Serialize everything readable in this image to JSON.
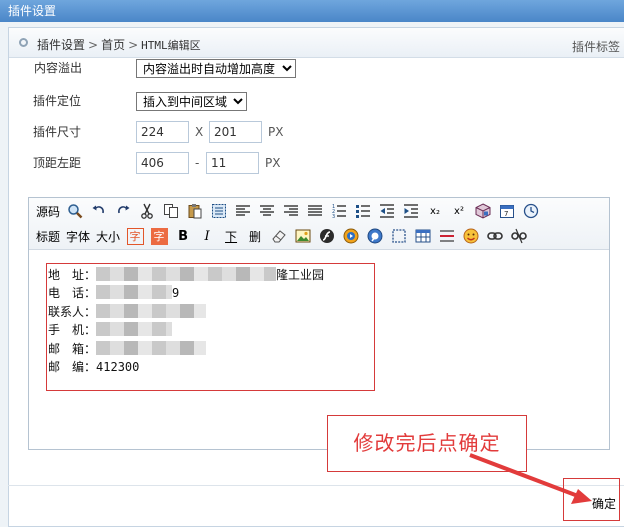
{
  "window": {
    "title": "插件设置"
  },
  "breadcrumb": {
    "items": [
      "插件设置",
      "首页",
      "HTML编辑区"
    ],
    "separator": ">",
    "right_label": "插件标签"
  },
  "form": {
    "overflow": {
      "label": "内容溢出",
      "value": "内容溢出时自动增加高度"
    },
    "position": {
      "label": "插件定位",
      "value": "插入到中间区域"
    },
    "size": {
      "label": "插件尺寸",
      "width": "224",
      "x": "X",
      "height": "201",
      "unit": "PX"
    },
    "offset": {
      "label": "顶距左距",
      "top": "406",
      "dash": "-",
      "left": "11",
      "unit": "PX"
    }
  },
  "toolbar": {
    "source": "源码",
    "title": "标题",
    "font": "字体",
    "size": "大小",
    "font_color": "字",
    "bg_color": "字",
    "bold": "B",
    "italic": "I",
    "underline": "下",
    "strike": "删",
    "sub": "x₂",
    "sup": "x²"
  },
  "editor_content": {
    "lines": [
      {
        "label": "地　址：",
        "visible_tail": "隆工业园"
      },
      {
        "label": "电　话：",
        "visible_tail": "9"
      },
      {
        "label": "联系人：",
        "visible_tail": ""
      },
      {
        "label": "手　机：",
        "visible_tail": ""
      },
      {
        "label": "邮　箱：",
        "visible_tail": ""
      },
      {
        "label": "邮　编：",
        "visible_tail": "412300"
      }
    ]
  },
  "annotation": {
    "text": "修改完后点确定",
    "color": "#e23b3b"
  },
  "actions": {
    "confirm": "确定"
  },
  "colors": {
    "title_bar": "#5b96d4",
    "annotation": "#d53a3a"
  }
}
